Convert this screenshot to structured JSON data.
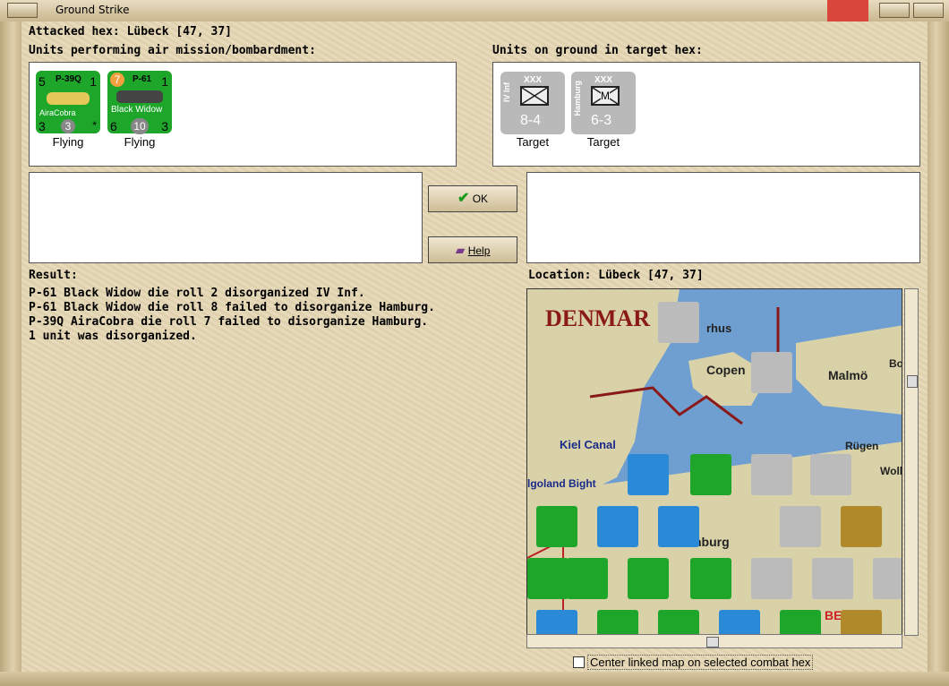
{
  "window": {
    "title": "Ground Strike"
  },
  "attacked_hex": "Attacked hex: Lübeck  [47, 37]",
  "air_units_label": "Units performing air mission/bombardment:",
  "ground_units_label": "Units on ground in target hex:",
  "air_units": [
    {
      "name": "P-39Q",
      "sub": "AiraCobra",
      "tl": "5",
      "tr": "1",
      "bl": "3",
      "mid": "3",
      "br": "*",
      "status": "Flying"
    },
    {
      "name": "P-61",
      "sub": "Black Widow",
      "tl": "7",
      "tr": "1",
      "bl": "6",
      "mid": "10",
      "br": "3",
      "status": "Flying"
    }
  ],
  "ground_units": [
    {
      "side": "IV Inf",
      "size": "XXX",
      "strength": "8-4",
      "symbol": "",
      "status": "Target"
    },
    {
      "side": "Hamburg",
      "size": "XXX",
      "strength": "6-3",
      "symbol": "M",
      "status": "Target"
    }
  ],
  "buttons": {
    "ok": "OK",
    "help": "Help"
  },
  "result_label": "Result:",
  "result_lines": [
    "P-61 Black Widow die roll 2 disorganized IV Inf.",
    "P-61 Black Widow die roll 8 failed to disorganize Hamburg.",
    "P-39Q AiraCobra die roll 7 failed to disorganize Hamburg.",
    "1 unit was disorganized."
  ],
  "location_label": "Location:  Lübeck  [47, 37]",
  "map_labels": {
    "denmark": "DENMAR",
    "arhus": "rhus",
    "copen": "Copen",
    "malmo": "Malmö",
    "kiel": "Kiel Canal",
    "rugen": "Rügen",
    "heligoland": "lgoland Bight",
    "burg": "nburg",
    "wol": "Woll",
    "bo": "Bo",
    "be": "BE"
  },
  "checkbox_label": "Center linked map on selected combat hex",
  "colors": {
    "unit_green": "#1ea62a",
    "unit_gray": "#b9b9b9",
    "sea": "#6f9fd0",
    "land": "#d9d2a8"
  }
}
